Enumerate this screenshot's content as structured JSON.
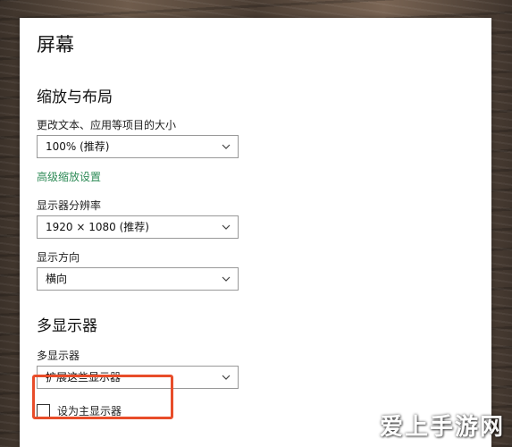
{
  "window": {
    "title": "屏幕"
  },
  "scale_layout": {
    "heading": "缩放与布局",
    "text_size_label": "更改文本、应用等项目的大小",
    "text_size_value": "100% (推荐)",
    "advanced_link": "高级缩放设置",
    "resolution_label": "显示器分辨率",
    "resolution_value": "1920 × 1080 (推荐)",
    "orientation_label": "显示方向",
    "orientation_value": "横向"
  },
  "multi_display": {
    "heading": "多显示器",
    "label": "多显示器",
    "value": "扩展这些显示器",
    "primary_checkbox_label": "设为主显示器",
    "primary_checked": false
  },
  "watermark": "爱上手游网",
  "colors": {
    "link": "#2e8b57",
    "highlight": "#e84d2a"
  },
  "icons": {
    "dropdown": "chevron-down-icon",
    "checkbox": "checkbox-icon"
  }
}
